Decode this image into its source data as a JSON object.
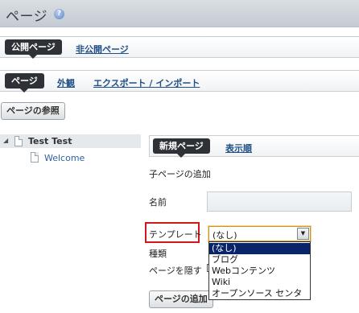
{
  "header": {
    "title": "ページ",
    "help_icon": "help-icon"
  },
  "top_tabs": {
    "active": "公開ページ",
    "other": "非公開ページ"
  },
  "sub_tabs": {
    "active": "ページ",
    "appearance": "外観",
    "export_import": "エクスポート / インポート"
  },
  "browse_button": "ページの参照",
  "tree": {
    "root": {
      "label": "Test Test",
      "icon": "page-icon"
    },
    "children": [
      {
        "label": "Welcome",
        "icon": "page-icon"
      }
    ]
  },
  "panel_tabs": {
    "active": "新規ページ",
    "other": "表示順"
  },
  "form": {
    "section_title": "子ページの追加",
    "name_label": "名前",
    "name_value": "",
    "template_label": "テンプレート",
    "template_selected": "(なし)",
    "template_options": [
      "(なし)",
      "ブログ",
      "Webコンテンツ",
      "Wiki",
      "オープンソース センタ"
    ],
    "type_label": "種類",
    "hide_label": "ページを隠す",
    "add_button": "ページの追加"
  },
  "colors": {
    "highlight": "#d0151b",
    "link": "#1f4f86",
    "dark_tab": "#2e3236",
    "selected_option": "#0a246a"
  }
}
